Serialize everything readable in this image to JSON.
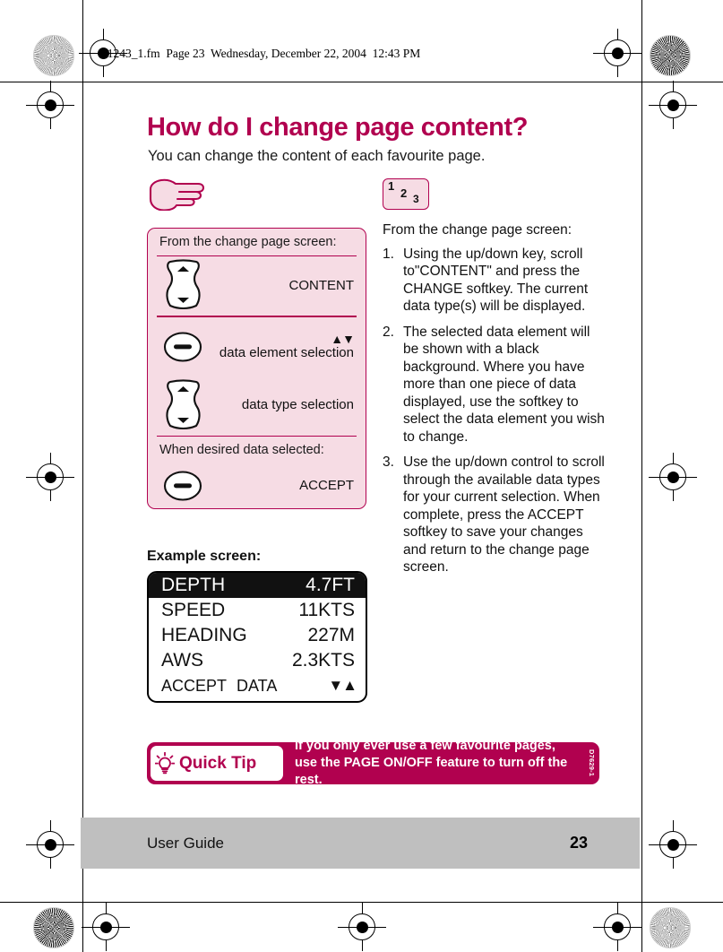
{
  "print": {
    "fm_header": "81243_1.fm  Page 23  Wednesday, December 22, 2004  12:43 PM"
  },
  "content": {
    "title": "How do I change page content?",
    "intro": "You can change the content of each favourite  page.",
    "hand_icon": "pointing-hand-icon",
    "steps_icon": {
      "n1": "1",
      "n2": "2",
      "n3": "3"
    }
  },
  "steps_panel": {
    "caption_top": "From the change page screen:",
    "caption_mid": "When desired data selected:",
    "rows": [
      {
        "key": "rocker-up-down-key",
        "label": "CONTENT",
        "arrows": ""
      },
      {
        "key": "oval-soft-key",
        "label": "data element selection",
        "arrows": "▲▼"
      },
      {
        "key": "rocker-up-down-key",
        "label": "data type selection",
        "arrows": ""
      },
      {
        "key": "oval-soft-key",
        "label": "ACCEPT",
        "arrows": ""
      }
    ]
  },
  "example": {
    "label": "Example screen:",
    "rows": [
      {
        "name": "DEPTH",
        "value": "4.7FT",
        "selected": true
      },
      {
        "name": "SPEED",
        "value": "11KTS",
        "selected": false
      },
      {
        "name": "HEADING",
        "value": "227M",
        "selected": false
      },
      {
        "name": "AWS",
        "value": "2.3KTS",
        "selected": false
      }
    ],
    "softkeys": {
      "left": "ACCEPT",
      "middle": "DATA",
      "right": "▼▲"
    }
  },
  "instructions": {
    "lead": "From the change page screen:",
    "items": [
      {
        "num": "1.",
        "text": "Using the up/down key, scroll to\"CONTENT\" and press the CHANGE softkey. The current data type(s) will be displayed."
      },
      {
        "num": "2.",
        "text": "The selected data element will be shown with a black background. Where you have more than one piece of data displayed, use the softkey to select the data element you wish to change."
      },
      {
        "num": "3.",
        "text": "Use the up/down control to scroll through the available data types for your current selection. When complete, press the ACCEPT softkey to save your changes and return to the change page screen."
      }
    ]
  },
  "quick_tip": {
    "badge": "Quick Tip",
    "icon": "lightbulb-icon",
    "text": "If you only ever use a few favourite pages, use the PAGE ON/OFF feature to turn off the rest.",
    "code": "D7629-1"
  },
  "footer": {
    "name": "User Guide",
    "page": "23"
  },
  "colors": {
    "brand": "#B1014F",
    "panel_fill": "#F6DCE4",
    "footer_bg": "#BFBFBF",
    "lcd_selected_bg": "#111111"
  }
}
